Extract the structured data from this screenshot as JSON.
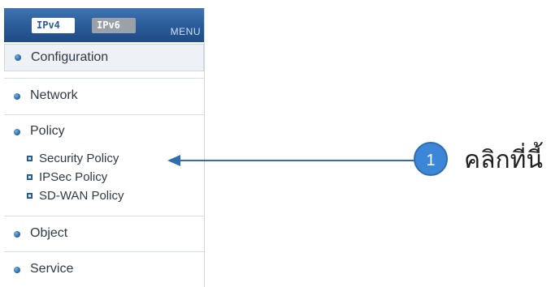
{
  "sidebar": {
    "tabs": [
      {
        "label": "IPv4",
        "active": true
      },
      {
        "label": "IPv6",
        "active": false
      }
    ],
    "menu_label": "MENU",
    "items": [
      {
        "label": "Configuration",
        "selected": true
      },
      {
        "label": "Network"
      },
      {
        "label": "Policy",
        "expanded": true,
        "children": [
          "Security Policy",
          "IPSec Policy",
          "SD-WAN Policy"
        ]
      },
      {
        "label": "Object"
      },
      {
        "label": "Service"
      }
    ]
  },
  "callout": {
    "step": "1",
    "text": "คลิกที่นี้"
  },
  "colors": {
    "header": "#2a5a98",
    "accent": "#2f6fb0",
    "badge": "#3c86d8"
  }
}
